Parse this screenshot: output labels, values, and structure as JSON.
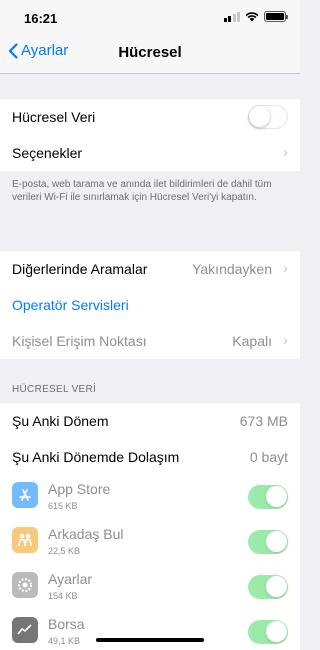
{
  "status_bar": {
    "time": "16:21"
  },
  "nav": {
    "back_label": "Ayarlar",
    "title": "Hücresel"
  },
  "cellular_data": {
    "label": "Hücresel Veri",
    "enabled": false
  },
  "options": {
    "label": "Seçenekler"
  },
  "footer_note": "E-posta, web tarama ve anında ilet bildirimleri de dahil tüm verileri Wi-Fi ile sınırlamak için Hücresel Veri'yi kapatın.",
  "calls_on_other": {
    "label": "Diğerlerinde Aramalar",
    "value": "Yakındayken"
  },
  "carrier_services": {
    "label": "Operatör Servisleri"
  },
  "personal_hotspot": {
    "label": "Kişisel Erişim Noktası",
    "value": "Kapalı"
  },
  "usage_section_header": "HÜCRESEL VERİ",
  "current_period": {
    "label": "Şu Anki Dönem",
    "value": "673 MB"
  },
  "current_roaming": {
    "label": "Şu Anki Dönemde Dolaşım",
    "value": "0 bayt"
  },
  "apps": [
    {
      "name": "App Store",
      "size": "615 KB",
      "icon": "app-store-icon",
      "color": "#1a8cff",
      "enabled": true
    },
    {
      "name": "Arkadaş Bul",
      "size": "22,5 KB",
      "icon": "find-friends-icon",
      "color": "#f5a623",
      "enabled": true
    },
    {
      "name": "Ayarlar",
      "size": "154 KB",
      "icon": "settings-icon",
      "color": "#8e8e93",
      "enabled": true
    },
    {
      "name": "Borsa",
      "size": "49,1 KB",
      "icon": "stocks-icon",
      "color": "#1c1c1e",
      "enabled": true
    }
  ]
}
